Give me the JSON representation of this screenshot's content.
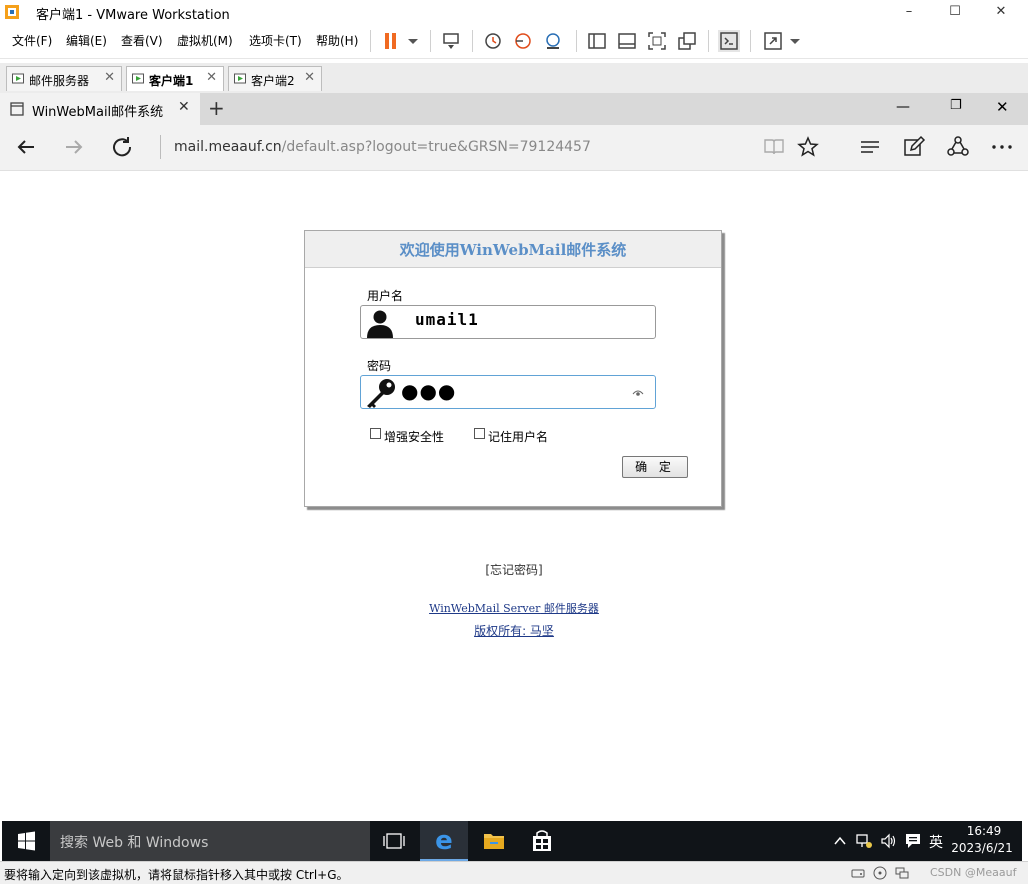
{
  "vmware": {
    "window_title": "客户端1 - VMware Workstation",
    "menu": [
      "文件(F)",
      "编辑(E)",
      "查看(V)",
      "虚拟机(M)",
      "选项卡(T)",
      "帮助(H)"
    ],
    "tabs": [
      {
        "label": "邮件服务器",
        "active": false
      },
      {
        "label": "客户端1",
        "active": true
      },
      {
        "label": "客户端2",
        "active": false
      }
    ],
    "status_text": "要将输入定向到该虚拟机，请将鼠标指针移入其中或按 Ctrl+G。",
    "watermark": "CSDN @Meaauf"
  },
  "browser": {
    "tab_title": "WinWebMail邮件系统",
    "address_host": "mail.meaauf.cn",
    "address_path": "/default.asp?logout=true&GRSN=79124457"
  },
  "login": {
    "title": "欢迎使用WinWebMail邮件系统",
    "username_label": "用户名",
    "username_value": "umail1",
    "password_label": "密码",
    "password_mask": "●●●",
    "enhanced_security_label": "增强安全性",
    "remember_username_label": "记住用户名",
    "ok_button": "确 定",
    "forgot_password_link": "[忘记密码]",
    "server_link_latin": "WinWebMail Server",
    "server_link_cn": " 邮件服务器",
    "copyright_link": "版权所有: 马坚"
  },
  "taskbar": {
    "search_placeholder": "搜索 Web 和 Windows",
    "ime": "英",
    "time": "16:49",
    "date": "2023/6/21"
  },
  "colors": {
    "title_accent": "#5b8fc7",
    "pause_orange": "#f06a22",
    "taskbar_bg": "#101418",
    "link_blue": "#1f3a88"
  }
}
